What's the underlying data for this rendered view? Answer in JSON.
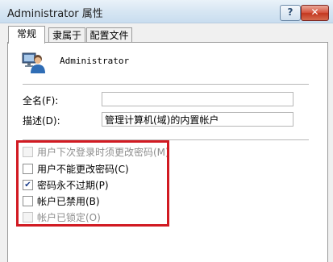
{
  "window": {
    "title": "Administrator 属性",
    "help_label": "?",
    "close_label": "✕"
  },
  "tabs": [
    {
      "label": "常规",
      "active": true
    },
    {
      "label": "隶属于",
      "active": false
    },
    {
      "label": "配置文件",
      "active": false
    }
  ],
  "user": {
    "name": "Administrator",
    "icon": "user-account-icon"
  },
  "fields": {
    "fullname": {
      "label": "全名(F):",
      "value": ""
    },
    "description": {
      "label": "描述(D):",
      "value": "管理计算机(域)的内置帐户"
    }
  },
  "options": [
    {
      "label": "用户下次登录时须更改密码(M)",
      "checked": false,
      "enabled": false
    },
    {
      "label": "用户不能更改密码(C)",
      "checked": false,
      "enabled": true
    },
    {
      "label": "密码永不过期(P)",
      "checked": true,
      "enabled": true
    },
    {
      "label": "帐户已禁用(B)",
      "checked": false,
      "enabled": true
    },
    {
      "label": "帐户已锁定(O)",
      "checked": false,
      "enabled": false
    }
  ],
  "colors": {
    "highlight_border": "#d11a22",
    "titlebar": "#d7e6f3",
    "close_button": "#c3381f"
  }
}
